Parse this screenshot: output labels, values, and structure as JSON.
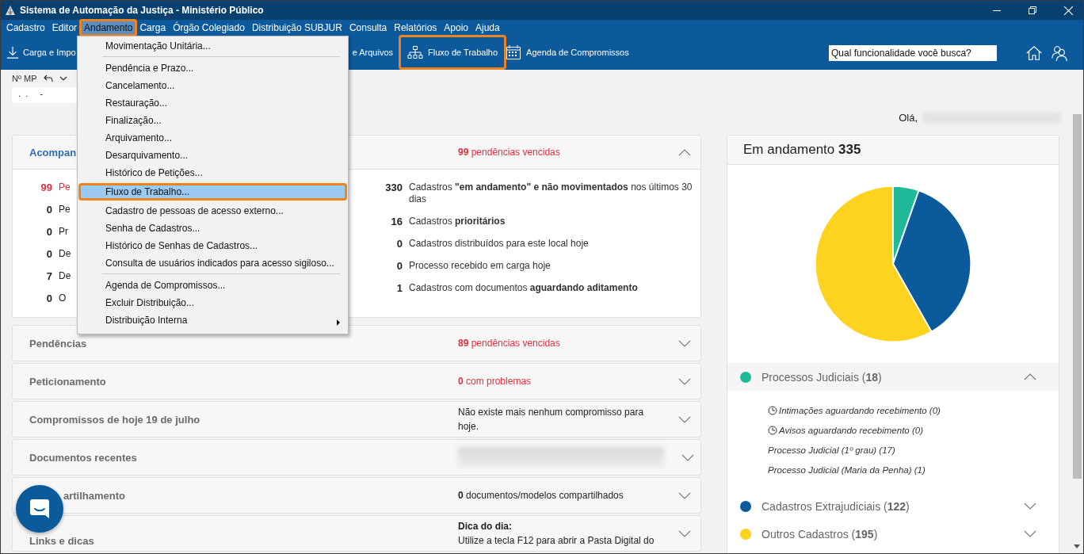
{
  "window": {
    "title": "Sistema de Automação da Justiça - Ministério Público"
  },
  "menu_bar": [
    {
      "label": "Cadastro",
      "selected": false,
      "highlighted": false
    },
    {
      "label": "Editor",
      "selected": false,
      "highlighted": false
    },
    {
      "label": "Andamento",
      "selected": true,
      "highlighted": true
    },
    {
      "label": "Carga",
      "selected": false,
      "highlighted": false
    },
    {
      "label": "Órgão Colegiado",
      "selected": false,
      "highlighted": false
    },
    {
      "label": "Distribuição SUBJUR",
      "selected": false,
      "highlighted": false
    },
    {
      "label": "Consulta",
      "selected": false,
      "highlighted": false
    },
    {
      "label": "Relatórios",
      "selected": false,
      "highlighted": false
    },
    {
      "label": "Apoio",
      "selected": false,
      "highlighted": false
    },
    {
      "label": "Ajuda",
      "selected": false,
      "highlighted": false
    }
  ],
  "toolbar": {
    "buttons": [
      {
        "label": "Carga e Impo",
        "kind": "download",
        "highlighted": false
      },
      {
        "label": "e Arquivos",
        "kind": "text",
        "highlighted": false
      },
      {
        "label": "Fluxo de Trabalho",
        "kind": "flow",
        "highlighted": true
      },
      {
        "label": "Agenda de Compromissos",
        "kind": "calendar",
        "highlighted": false
      }
    ],
    "search": {
      "placeholder": "Qual funcionalidade você busca?"
    }
  },
  "mp_field": {
    "label": "Nº MP",
    "value": ".  .     -"
  },
  "greeting": "Olá,",
  "dropdown": {
    "groups": [
      {
        "items": [
          {
            "label": "Movimentação Unitária...",
            "selected": false,
            "highlighted": false,
            "submenu": false
          }
        ]
      },
      {
        "items": [
          {
            "label": "Pendência e Prazo...",
            "selected": false,
            "highlighted": false,
            "submenu": false
          },
          {
            "label": "Cancelamento...",
            "selected": false,
            "highlighted": false,
            "submenu": false
          },
          {
            "label": "Restauração...",
            "selected": false,
            "highlighted": false,
            "submenu": false
          },
          {
            "label": "Finalização...",
            "selected": false,
            "highlighted": false,
            "submenu": false
          },
          {
            "label": "Arquivamento...",
            "selected": false,
            "highlighted": false,
            "submenu": false
          },
          {
            "label": "Desarquivamento...",
            "selected": false,
            "highlighted": false,
            "submenu": false
          },
          {
            "label": "Histórico de Petições...",
            "selected": false,
            "highlighted": false,
            "submenu": false
          },
          {
            "label": "Fluxo de Trabalho...",
            "selected": true,
            "highlighted": true,
            "submenu": false
          },
          {
            "label": "Cadastro de pessoas de acesso externo...",
            "selected": false,
            "highlighted": false,
            "submenu": false
          },
          {
            "label": "Senha de Cadastros...",
            "selected": false,
            "highlighted": false,
            "submenu": false
          },
          {
            "label": "Histórico de Senhas de Cadastros...",
            "selected": false,
            "highlighted": false,
            "submenu": false
          },
          {
            "label": "Consulta de usuários indicados para acesso sigiloso...",
            "selected": false,
            "highlighted": false,
            "submenu": false
          }
        ]
      },
      {
        "items": [
          {
            "label": "Agenda de Compromissos...",
            "selected": false,
            "highlighted": false,
            "submenu": false
          },
          {
            "label": "Excluir Distribuição...",
            "selected": false,
            "highlighted": false,
            "submenu": false
          },
          {
            "label": "Distribuição Interna",
            "selected": false,
            "highlighted": false,
            "submenu": true
          }
        ]
      }
    ]
  },
  "panels": [
    {
      "kind": "summary",
      "title": "Acompan",
      "status": "**99** pendências vencidas",
      "alert": true,
      "expanded": true,
      "under_chat_button": false,
      "left_items": [
        {
          "count": "99",
          "text": "Pe",
          "alert": true
        },
        {
          "count": "0",
          "text": "Pe",
          "alert": false
        },
        {
          "count": "0",
          "text": "Pr",
          "alert": false
        },
        {
          "count": "0",
          "text": "De",
          "alert": false
        },
        {
          "count": "7",
          "text": "De",
          "alert": false
        },
        {
          "count": "0",
          "text": "O",
          "alert": false
        }
      ],
      "right_items": [
        {
          "count": "330",
          "text": "Cadastros **\"em andamento\" e não movimentados** nos últimos 30 dias"
        },
        {
          "count": "16",
          "text": "Cadastros **prioritários**"
        },
        {
          "count": "0",
          "text": "Cadastros distribuídos para este local hoje"
        },
        {
          "count": "0",
          "text": "Processo recebido em carga hoje"
        },
        {
          "count": "1",
          "text": "Cadastros com documentos **aguardando aditamento**"
        }
      ]
    },
    {
      "kind": "status",
      "title": "Pendências",
      "status": "**89** pendências vencidas",
      "alert": true,
      "expanded": false,
      "under_chat_button": false
    },
    {
      "kind": "status",
      "title": "Peticionamento",
      "status": "**0** com problemas",
      "alert": true,
      "expanded": false,
      "under_chat_button": false
    },
    {
      "kind": "status",
      "title": "Compromissos de hoje 19 de julho",
      "status": "Não existe mais nenhum compromisso para hoje.",
      "alert": false,
      "expanded": false,
      "under_chat_button": false
    },
    {
      "kind": "blurred",
      "title": "Documentos recentes",
      "expanded": false,
      "under_chat_button": false
    },
    {
      "kind": "status",
      "title": "artilhamento",
      "status": "**0** documentos/modelos compartilhados",
      "alert": false,
      "expanded": false,
      "under_chat_button": true
    },
    {
      "kind": "tip",
      "title": "Links e dicas",
      "tip_title": "Dica do dia:",
      "tip_text": "Utilize a tecla F12 para abrir a Pasta Digital do",
      "expanded": false,
      "under_chat_button": false
    }
  ],
  "in_progress": {
    "total": "335",
    "chart_data": {
      "type": "pie",
      "categories": [
        "Processos Judiciais",
        "Cadastros Extrajudiciais",
        "Outros Cadastros"
      ],
      "series": [
        {
          "name": "Em andamento",
          "values": [
            5.37,
            36.42,
            58.21
          ]
        }
      ]
    },
    "legend": [
      {
        "count": "(**18**)",
        "color": "#1fbb98",
        "expanded": true,
        "children": [
          {
            "kind": "clock",
            "text": "Intimações aguardando recebimento (0)"
          },
          {
            "kind": "clock",
            "text": "Avisos aguardando recebimento (0)"
          },
          {
            "kind": "plain",
            "text": "Processo Judicial (1º grau) (17)"
          },
          {
            "kind": "plain",
            "text": "Processo Judicial (Maria da Penha) (1)"
          }
        ]
      },
      {
        "count": "(**122**)",
        "color": "#0b5a9c",
        "expanded": false
      },
      {
        "count": "(**195**)",
        "color": "#fdd31f",
        "expanded": false
      }
    ]
  }
}
